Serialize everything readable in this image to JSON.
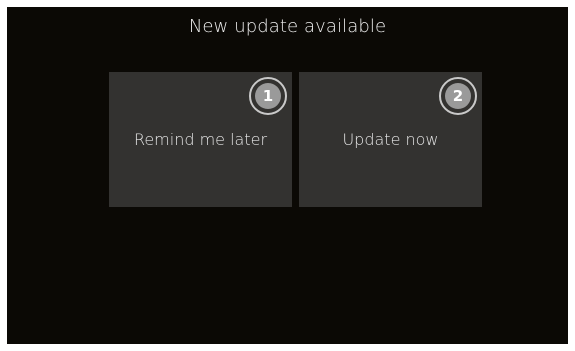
{
  "dialog": {
    "title": "New update available"
  },
  "options": [
    {
      "number": "1",
      "label": "Remind me later"
    },
    {
      "number": "2",
      "label": "Update now"
    }
  ],
  "colors": {
    "background": "#0b0905",
    "tile": "#333230",
    "badge_fill": "#9a9a9a",
    "badge_ring": "#c9c9c9",
    "text": "#e6e6e6"
  }
}
